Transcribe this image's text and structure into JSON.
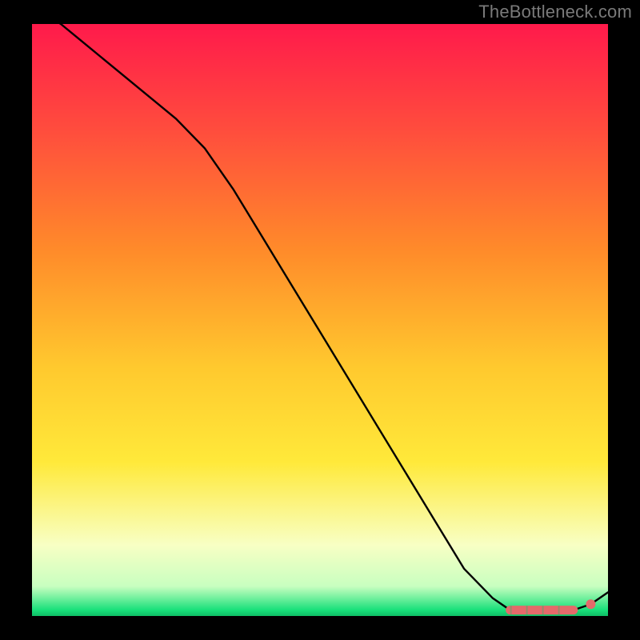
{
  "watermark": "TheBottleneck.com",
  "colors": {
    "gradient_top": "#ff1a4b",
    "gradient_mid_orange": "#ff8a2a",
    "gradient_yellow": "#ffe93a",
    "gradient_pale": "#f8ffc4",
    "gradient_green": "#18e07a",
    "line": "#000000",
    "marker_fill": "#e46a6a",
    "marker_stroke": "#c94f4f"
  },
  "chart_data": {
    "type": "line",
    "title": "",
    "xlabel": "",
    "ylabel": "",
    "xlim": [
      0,
      100
    ],
    "ylim": [
      0,
      100
    ],
    "series": [
      {
        "name": "curve",
        "x": [
          0,
          5,
          10,
          15,
          20,
          25,
          30,
          35,
          40,
          45,
          50,
          55,
          60,
          65,
          70,
          75,
          80,
          83,
          85,
          88,
          90,
          92,
          94,
          97,
          100
        ],
        "values": [
          103,
          100,
          96,
          92,
          88,
          84,
          79,
          72,
          64,
          56,
          48,
          40,
          32,
          24,
          16,
          8,
          3,
          1,
          1,
          1,
          1,
          1,
          1,
          2,
          4
        ]
      }
    ],
    "markers": {
      "name": "flat-region",
      "x": [
        83,
        85,
        88,
        90,
        92,
        94
      ],
      "values": [
        1,
        1,
        1,
        1,
        1,
        1
      ]
    },
    "end_marker": {
      "x": 97,
      "value": 2
    }
  }
}
